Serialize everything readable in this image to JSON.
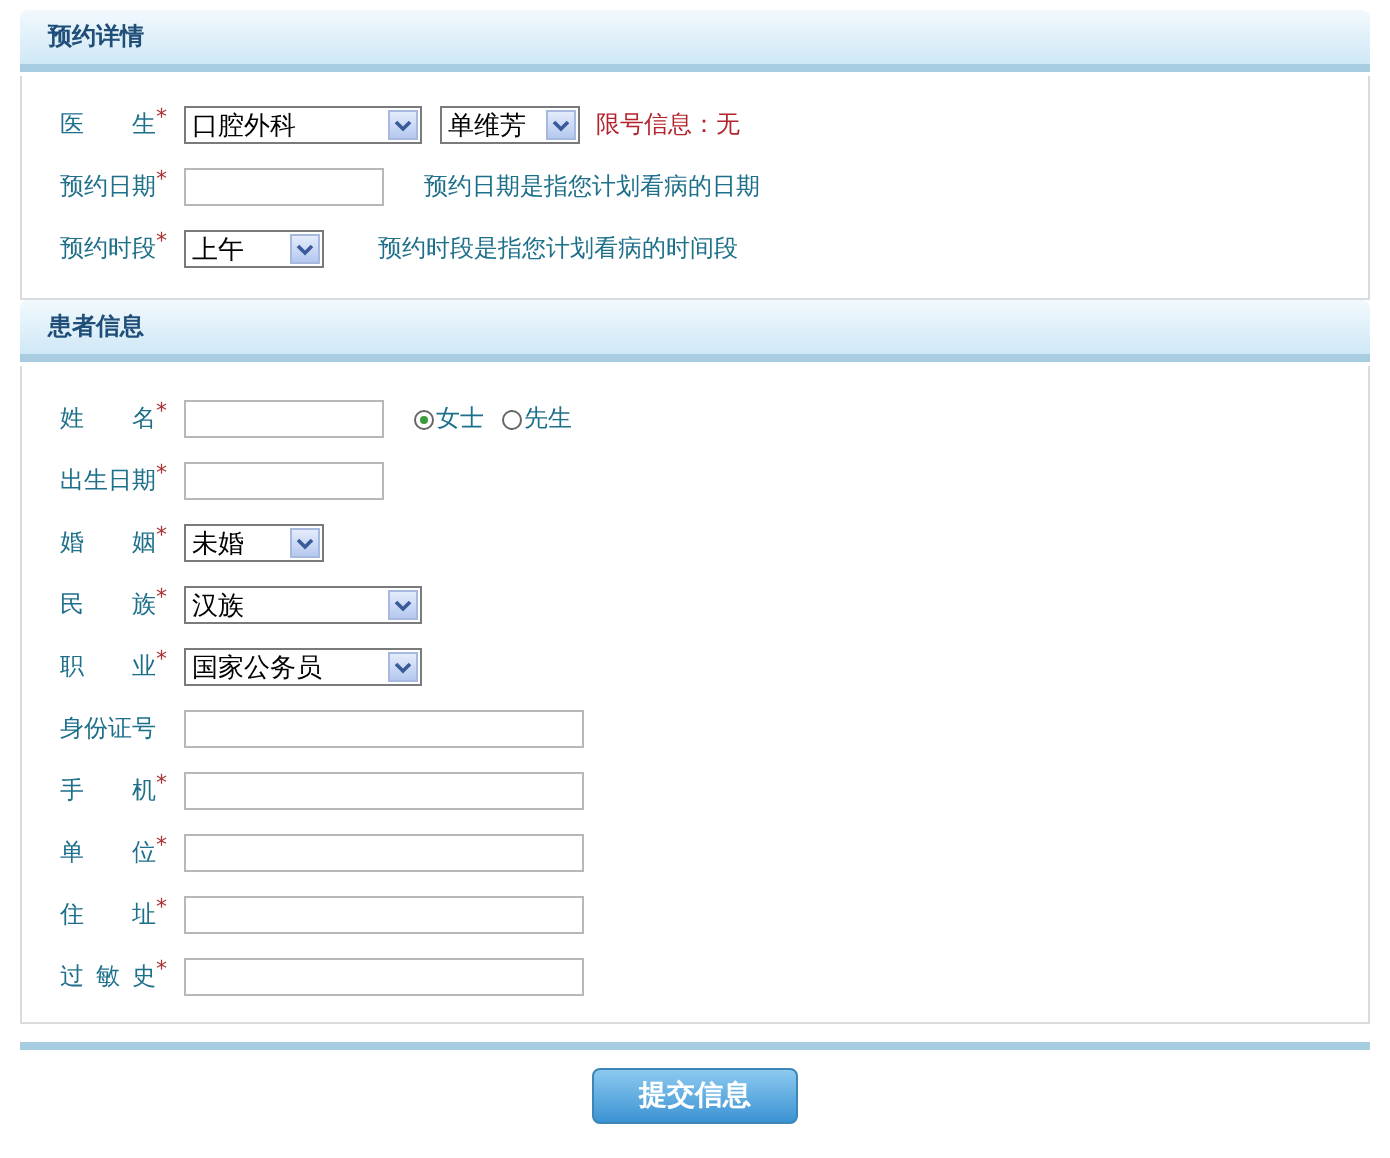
{
  "sections": [
    {
      "title": "预约详情",
      "rows": [
        {
          "label": "医 生",
          "mark": "*",
          "controls": [
            {
              "kind": "select",
              "value": "口腔外科"
            },
            {
              "kind": "select",
              "value": "单维芳"
            },
            {
              "kind": "alert",
              "text": "限号信息：无"
            }
          ]
        },
        {
          "label": "预约日期",
          "mark": "*",
          "controls": [
            {
              "kind": "input"
            },
            {
              "kind": "hint",
              "text": "预约日期是指您计划看病的日期"
            }
          ]
        },
        {
          "label": "预约时段",
          "mark": "*",
          "controls": [
            {
              "kind": "select",
              "value": "上午"
            },
            {
              "kind": "hint",
              "text": "预约时段是指您计划看病的时间段"
            }
          ]
        }
      ]
    },
    {
      "title": "患者信息",
      "rows": [
        {
          "label": "姓 名",
          "mark": "*",
          "controls": [
            {
              "kind": "input"
            },
            {
              "kind": "radios",
              "options": [
                {
                  "label": "女士",
                  "selected": true
                },
                {
                  "label": "先生",
                  "selected": false
                }
              ]
            }
          ]
        },
        {
          "label": "出生日期",
          "mark": "*",
          "controls": [
            {
              "kind": "input"
            }
          ]
        },
        {
          "label": "婚 姻",
          "mark": "*",
          "controls": [
            {
              "kind": "select",
              "value": "未婚"
            }
          ]
        },
        {
          "label": "民 族",
          "mark": "*",
          "controls": [
            {
              "kind": "select",
              "value": "汉族"
            }
          ]
        },
        {
          "label": "职 业",
          "mark": "*",
          "controls": [
            {
              "kind": "select",
              "value": "国家公务员"
            }
          ]
        },
        {
          "label": "身份证号",
          "controls": [
            {
              "kind": "input"
            }
          ]
        },
        {
          "label": "手 机",
          "mark": "*",
          "controls": [
            {
              "kind": "input"
            }
          ]
        },
        {
          "label": "单 位",
          "mark": "*",
          "controls": [
            {
              "kind": "input"
            }
          ]
        },
        {
          "label": "住 址",
          "mark": "*",
          "controls": [
            {
              "kind": "input"
            }
          ]
        },
        {
          "label": "过 敏 史",
          "mark": "*",
          "controls": [
            {
              "kind": "input"
            }
          ]
        }
      ]
    }
  ],
  "submit": "提交信息"
}
